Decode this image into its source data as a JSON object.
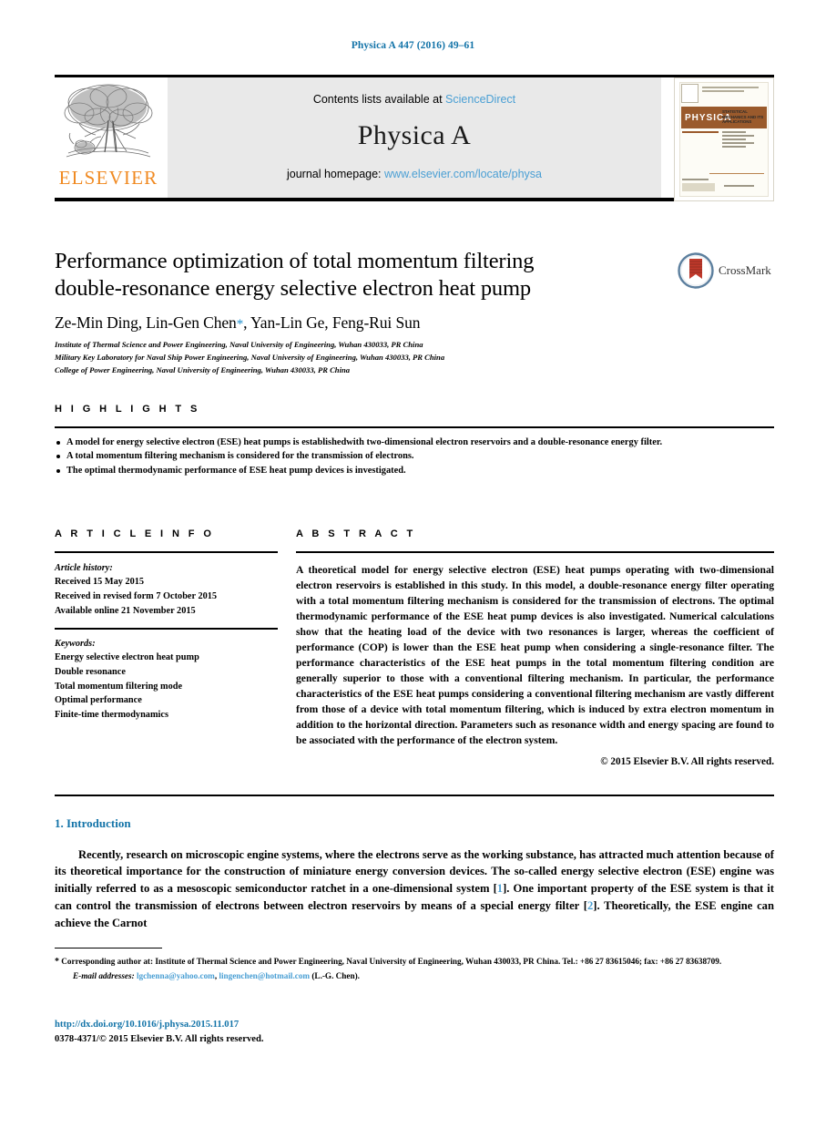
{
  "running_head": "Physica A 447 (2016) 49–61",
  "masthead": {
    "contents_prefix": "Contents lists available at",
    "sciencedirect_link": "ScienceDirect",
    "journal_name": "Physica A",
    "homepage_prefix": "journal homepage:",
    "homepage_link": "www.elsevier.com/locate/physa",
    "publisher_wordmark": "ELSEVIER",
    "cover": {
      "banner_title": "PHYSICA",
      "banner_letter": "A",
      "subtitle": "STATISTICAL MECHANICS AND ITS APPLICATIONS"
    }
  },
  "article": {
    "title_line1": "Performance optimization of total momentum filtering",
    "title_line2": "double-resonance energy selective electron heat pump",
    "authors_before_star": "Ze-Min Ding, Lin-Gen Chen",
    "corresponding_marker": "*",
    "authors_after_star": ", Yan-Lin Ge, Feng-Rui Sun",
    "affiliations": [
      "Institute of Thermal Science and Power Engineering, Naval University of Engineering, Wuhan 430033, PR China",
      "Military Key Laboratory for Naval Ship Power Engineering, Naval University of Engineering, Wuhan 430033, PR China",
      "College of Power Engineering, Naval University of Engineering, Wuhan 430033, PR China"
    ],
    "crossmark_label": "CrossMark"
  },
  "highlights": {
    "section_label": "H I G H L I G H T S",
    "items": [
      "A model for energy selective electron (ESE) heat pumps is establishedwith two-dimensional electron reservoirs and a double-resonance energy filter.",
      "A total momentum filtering mechanism is considered for the transmission of electrons.",
      "The optimal thermodynamic performance of ESE heat pump devices is investigated."
    ]
  },
  "article_info": {
    "section_label": "A R T I C L E    I N F O",
    "history_label": "Article history:",
    "history": [
      "Received 15 May 2015",
      "Received in revised form 7 October 2015",
      "Available online 21 November 2015"
    ],
    "keywords_label": "Keywords:",
    "keywords": [
      "Energy selective electron heat pump",
      "Double resonance",
      "Total momentum filtering mode",
      "Optimal performance",
      "Finite-time thermodynamics"
    ]
  },
  "abstract": {
    "section_label": "A B S T R A C T",
    "text": "A theoretical model for energy selective electron (ESE) heat pumps operating with two-dimensional electron reservoirs is established in this study. In this model, a double-resonance energy filter operating with a total momentum filtering mechanism is considered for the transmission of electrons. The optimal thermodynamic performance of the ESE heat pump devices is also investigated. Numerical calculations show that the heating load of the device with two resonances is larger, whereas the coefficient of performance (COP) is lower than the ESE heat pump when considering a single-resonance filter. The performance characteristics of the ESE heat pumps in the total momentum filtering condition are generally superior to those with a conventional filtering mechanism. In particular, the performance characteristics of the ESE heat pumps considering a conventional filtering mechanism are vastly different from those of a device with total momentum filtering, which is induced by extra electron momentum in addition to the horizontal direction. Parameters such as resonance width and energy spacing are found to be associated with the performance of the electron system.",
    "copyright": "© 2015 Elsevier B.V. All rights reserved."
  },
  "introduction": {
    "heading": "1. Introduction",
    "paragraph_part1": "Recently, research on microscopic engine systems, where the electrons serve as the working substance, has attracted much attention because of its theoretical importance for the construction of miniature energy conversion devices. The so-called energy selective electron (ESE) engine was initially referred to as a mesoscopic semiconductor ratchet in a one-dimensional system [",
    "citation1": "1",
    "paragraph_part2": "]. One important property of the ESE system is that it can control the transmission of electrons between electron reservoirs by means of a special energy filter [",
    "citation2": "2",
    "paragraph_part3": "]. Theoretically, the ESE engine can achieve the Carnot"
  },
  "footer": {
    "footnote_star": "*",
    "footnote_text": "Corresponding author at: Institute of Thermal Science and Power Engineering, Naval University of Engineering, Wuhan 430033, PR China. Tel.: +86 27 83615046; fax: +86 27 83638709.",
    "email_label": "E-mail addresses:",
    "email1": "lgchenna@yahoo.com",
    "email_sep": ", ",
    "email2": "lingenchen@hotmail.com",
    "email_suffix": " (L.-G. Chen).",
    "doi": "http://dx.doi.org/10.1016/j.physa.2015.11.017",
    "issn_line": "0378-4371/© 2015 Elsevier B.V. All rights reserved."
  },
  "colors": {
    "link_blue": "#4a9fd4",
    "heading_blue": "#1273a8",
    "elsevier_orange": "#f08a22",
    "masthead_grey": "#e9e9e9"
  }
}
